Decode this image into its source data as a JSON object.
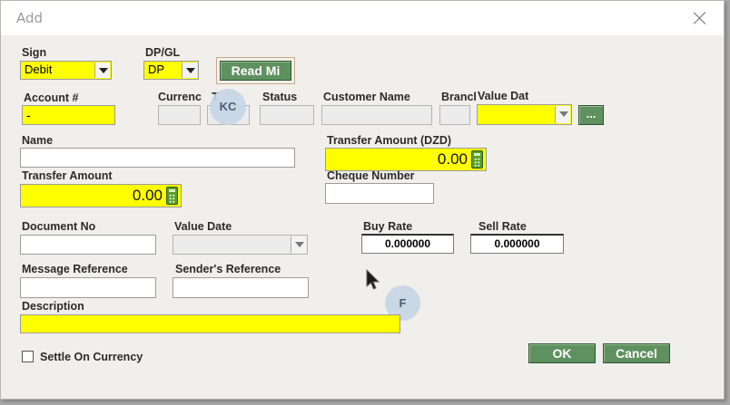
{
  "dialog": {
    "title": "Add",
    "sign": {
      "label": "Sign",
      "value": "Debit"
    },
    "dpgl": {
      "label": "DP/GL",
      "value": "DP"
    },
    "read_button": "Read Mi",
    "account": {
      "label": "Account #",
      "value": "-"
    },
    "currency_label": "Currenc",
    "type_label": "T",
    "status_label": "Status",
    "customer_name_label": "Customer Name",
    "branch_label": "Brancl",
    "value_date_top_label": "Value Dat",
    "ellipsis_button": "...",
    "name_label": "Name",
    "transfer_amount_dzd": {
      "label": "Transfer Amount (DZD)",
      "value": "0.00"
    },
    "transfer_amount": {
      "label": "Transfer Amount",
      "value": "0.00"
    },
    "cheque_number_label": "Cheque Number",
    "document_no_label": "Document No",
    "value_date_label": "Value Date",
    "buy_rate": {
      "label": "Buy Rate",
      "value": "0.000000"
    },
    "sell_rate": {
      "label": "Sell Rate",
      "value": "0.000000"
    },
    "message_reference_label": "Message Reference",
    "senders_reference_label": "Sender's Reference",
    "description_label": "Description",
    "settle_on_currency_label": "Settle On Currency",
    "ok_button": "OK",
    "cancel_button": "Cancel"
  },
  "overlays": {
    "kc_badge": "KC",
    "f_badge": "F"
  },
  "icons": {
    "close": "close-icon",
    "dropdown": "chevron-down-icon",
    "calculator": "calculator-icon",
    "cursor": "mouse-pointer-icon"
  },
  "colors": {
    "required_field": "#ffff00",
    "button_green": "#5f9060",
    "dialog_bg": "#f1efeb"
  }
}
